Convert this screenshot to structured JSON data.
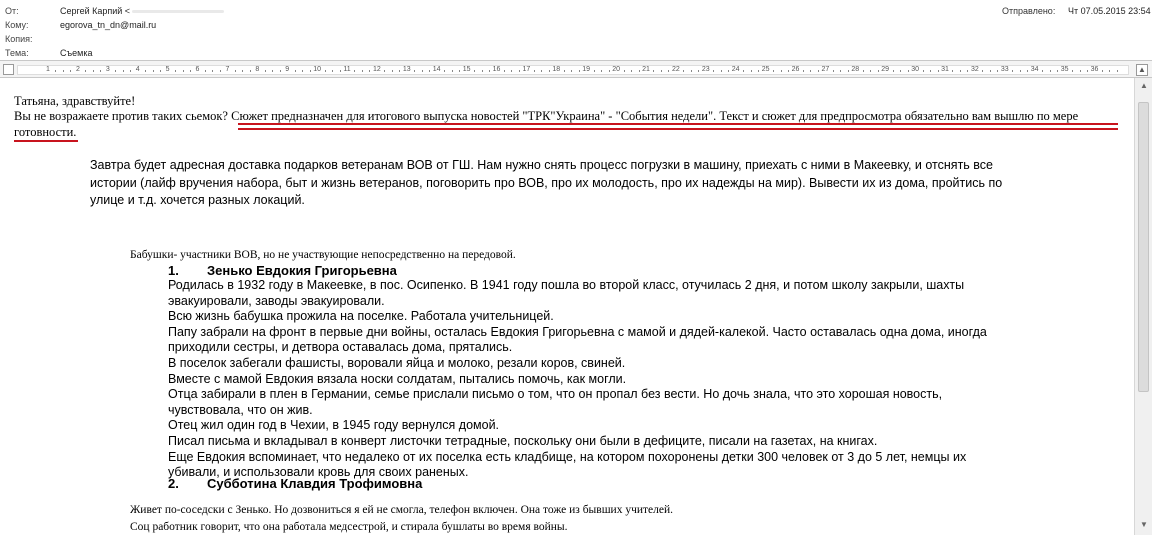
{
  "header": {
    "from_label": "От:",
    "from_value": "Сергей Карпий <",
    "to_label": "Кому:",
    "to_value": "egorova_tn_dn@mail.ru",
    "cc_label": "Копия:",
    "cc_value": "",
    "subject_label": "Тема:",
    "subject_value": "Съемка",
    "sent_label": "Отправлено:",
    "sent_value": "Чт 07.05.2015 23:54"
  },
  "ruler": {
    "numbers": [
      "1",
      "2",
      "3",
      "4",
      "5",
      "6",
      "7",
      "8",
      "9",
      "10",
      "11",
      "12",
      "13",
      "14",
      "15",
      "16",
      "17",
      "18",
      "19",
      "20",
      "21",
      "22",
      "23",
      "24",
      "25",
      "26",
      "27",
      "28",
      "29",
      "30",
      "31",
      "32",
      "33",
      "34",
      "35",
      "36"
    ]
  },
  "message": {
    "greeting": "Татьяна, здравствуйте!",
    "line2_prefix": "Вы не возражаете против таких сьемок?",
    "line2_highlight": "Сюжет предназначен для итогового выпуска новостей \"ТРК\"Украина\"  - \"События недели\". Текст и сюжет для предпросмотра обязательно вам вышлю по мере",
    "line3_highlight": "готовности.",
    "intro": [
      "Завтра будет адресная доставка подарков ветеранам ВОВ от ГШ. Нам нужно снять процесс погрузки в машину, приехать с ними в Макеевку, и отснять все",
      "истории (лайф вручения набора, быт и жизнь ветеранов, поговорить про ВОВ, про их молодость, про их надежды на мир). Вывести их из дома, пройтись по",
      "улице и т.д. хочется разных локаций."
    ],
    "section_title": "Бабушки- участники ВОВ, но не участвующие непосредственно на  передовой.",
    "person1": {
      "number": "1.",
      "name": "Зенько Евдокия Григорьевна",
      "lines": [
        "Родилась в 1932 году в Макеевке, в пос. Осипенко. В 1941 году пошла во второй класс, отучилась 2 дня, и потом школу закрыли, шахты",
        "эвакуировали, заводы эвакуировали.",
        "Всю жизнь бабушка прожила на поселке. Работала учительницей.",
        "Папу забрали на фронт в первые дни войны, осталась Евдокия Григорьевна с мамой и дядей-калекой. Часто оставалась одна дома, иногда",
        "приходили сестры, и детвора оставалась дома, прятались.",
        "В поселок забегали фашисты, воровали яйца и молоко, резали коров, свиней.",
        "Вместе с мамой Евдокия вязала носки солдатам, пытались помочь, как могли.",
        "Отца забирали в плен в Германии, семье прислали письмо о том, что он пропал без вести. Но дочь знала, что это хорошая новость,",
        "чувствовала, что он жив.",
        "Отец жил один год в Чехии, в 1945 году вернулся домой.",
        "Писал письма и вкладывал в конверт листочки тетрадные, поскольку они были в дефиците, писали на газетах, на книгах.",
        "Еще Евдокия вспоминает, что недалеко от их поселка есть кладбище, на котором похоронены детки 300 человек от 3 до 5 лет, немцы их",
        "убивали, и использовали кровь для своих раненых."
      ]
    },
    "person2": {
      "number": "2.",
      "name": "Субботина Клавдия Трофимовна"
    },
    "tail": [
      "Живет по-соседски с Зенько. Но дозвониться я ей не смогла, телефон включен. Она тоже из бывших учителей.",
      "Соц работник говорит, что она работала медсестрой, и стирала бушлаты во время войны."
    ]
  },
  "colors": {
    "underline": "#c8141e",
    "text": "#000000"
  },
  "icons": {
    "ruler_toggle": "ruler-toggle-icon",
    "scroll_up": "chevron-up-icon",
    "scroll_down": "chevron-down-icon"
  }
}
